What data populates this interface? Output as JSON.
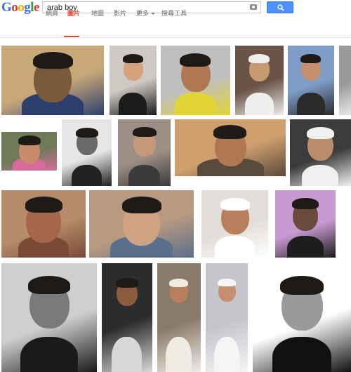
{
  "header": {
    "logo_letters": [
      {
        "char": "G",
        "color": "#3a6ee8"
      },
      {
        "char": "o",
        "color": "#d63a2f"
      },
      {
        "char": "o",
        "color": "#f1b300"
      },
      {
        "char": "g",
        "color": "#3a6ee8"
      },
      {
        "char": "l",
        "color": "#2a9d47"
      },
      {
        "char": "e",
        "color": "#d63a2f"
      }
    ],
    "search_query": "arab boy"
  },
  "tabs": [
    {
      "label": "網頁",
      "active": false
    },
    {
      "label": "圖片",
      "active": true
    },
    {
      "label": "地圖",
      "active": false
    },
    {
      "label": "影片",
      "active": false
    },
    {
      "label": "更多",
      "active": false,
      "has_caret": true
    },
    {
      "label": "搜尋工具",
      "active": false
    }
  ],
  "colors": {
    "accent_red": "#dd4b39",
    "search_blue": "#4d90fe"
  },
  "results": {
    "image_tiles": [
      {
        "desc": "smiling-boy-blue-shirt",
        "palette": [
          "#c9a878",
          "#7a5a3c",
          "#2c3f6e"
        ]
      },
      {
        "desc": "boy-in-suit-drinking",
        "palette": [
          "#cfc9c4",
          "#d4a27a",
          "#1c1c1c"
        ]
      },
      {
        "desc": "young-man-yellow-shirt",
        "palette": [
          "#bfbfbf",
          "#b07852",
          "#e2d434"
        ]
      },
      {
        "desc": "boy-white-headscarf",
        "palette": [
          "#6b5347",
          "#c79a6f",
          "#eeeeee"
        ]
      },
      {
        "desc": "boy-checkered-scarf",
        "palette": [
          "#7e9ec8",
          "#c49070",
          "#2b2b2b"
        ]
      },
      {
        "desc": "partial-bw",
        "palette": [
          "#9a9a9a",
          "#cccccc",
          "#e8e8e8"
        ]
      },
      {
        "desc": "girl-pink-scarf",
        "palette": [
          "#6f7a58",
          "#c78c6a",
          "#d96b9c"
        ]
      },
      {
        "desc": "bw-child-veil",
        "palette": [
          "#e6e6e6",
          "#6a6a6a",
          "#222222"
        ]
      },
      {
        "desc": "boy-light-brown",
        "palette": [
          "#9d8f85",
          "#c5987a",
          "#3b3b3b"
        ]
      },
      {
        "desc": "man-desert-lying",
        "palette": [
          "#cf9f6e",
          "#b07852",
          "#5a4a3c"
        ]
      },
      {
        "desc": "boy-white-kufi",
        "palette": [
          "#3c3c3c",
          "#b98c6c",
          "#f0f0f0"
        ]
      },
      {
        "desc": "child-orange-sepia",
        "palette": [
          "#b68c6a",
          "#a6664c",
          "#7a4a36"
        ]
      },
      {
        "desc": "two-boys-classroom",
        "palette": [
          "#b99a80",
          "#d0a284",
          "#5a6f8c"
        ]
      },
      {
        "desc": "boy-patterned-kufi",
        "palette": [
          "#e2ddd8",
          "#b77f5c",
          "#ffffff"
        ]
      },
      {
        "desc": "young-man-purple-bg",
        "palette": [
          "#c99ad1",
          "#6a4a3c",
          "#1d1d1d"
        ]
      },
      {
        "desc": "bw-man-glasses",
        "palette": [
          "#cfcfcf",
          "#7a7a7a",
          "#1a1a1a"
        ]
      },
      {
        "desc": "boy-dark-bg-smile",
        "palette": [
          "#2c2c2c",
          "#8c5a3c",
          "#d8d8d8"
        ]
      },
      {
        "desc": "boy-tribal-dress",
        "palette": [
          "#8a7a6a",
          "#b77f5c",
          "#f0ece4"
        ]
      },
      {
        "desc": "boy-white-robe",
        "palette": [
          "#c4c6cc",
          "#c49070",
          "#f5f5f5"
        ]
      },
      {
        "desc": "bw-curly-boy",
        "palette": [
          "#ffffff",
          "#9a9a9a",
          "#111111"
        ]
      }
    ]
  }
}
